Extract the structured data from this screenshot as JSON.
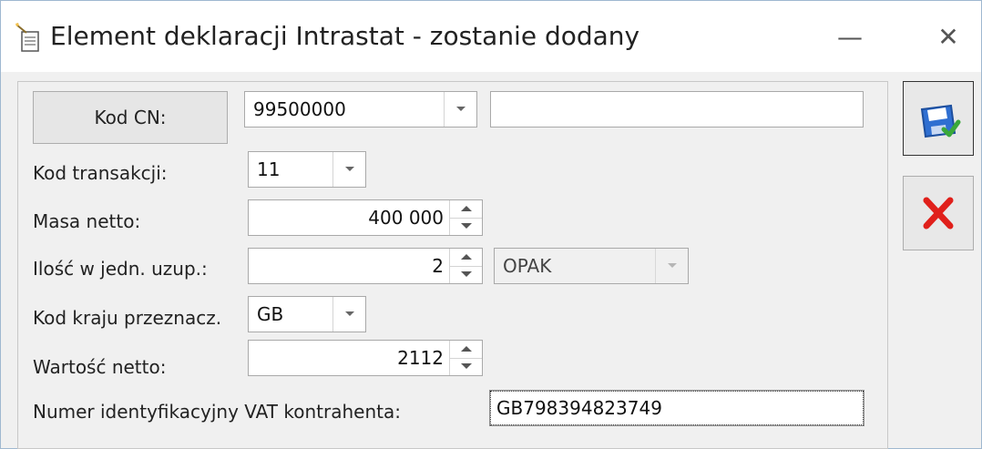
{
  "window": {
    "title": "Element deklaracji Intrastat - zostanie dodany",
    "minimize_glyph": "—",
    "close_glyph": "✕"
  },
  "form": {
    "kod_cn_button": "Kod CN:",
    "kod_cn_value": "99500000",
    "kod_cn_description": "",
    "kod_transakcji_label": "Kod transakcji:",
    "kod_transakcji_value": "11",
    "masa_netto_label": "Masa netto:",
    "masa_netto_value": "400 000",
    "ilosc_label": "Ilość w jedn. uzup.:",
    "ilosc_value": "2",
    "jednostka_value": "OPAK",
    "kod_kraju_label": "Kod kraju przeznacz.",
    "kod_kraju_value": "GB",
    "wartosc_netto_label": "Wartość netto:",
    "wartosc_netto_value": "2112",
    "vat_label": "Numer identyfikacyjny VAT kontrahenta:",
    "vat_value": "GB798394823749"
  },
  "icons": {
    "title": "document-wand-icon",
    "save": "save-floppy-check-icon",
    "cancel": "red-x-cancel-icon"
  },
  "colors": {
    "save_blue": "#2f6fd1",
    "check_green": "#3aa83a",
    "cancel_red": "#e0201b"
  }
}
